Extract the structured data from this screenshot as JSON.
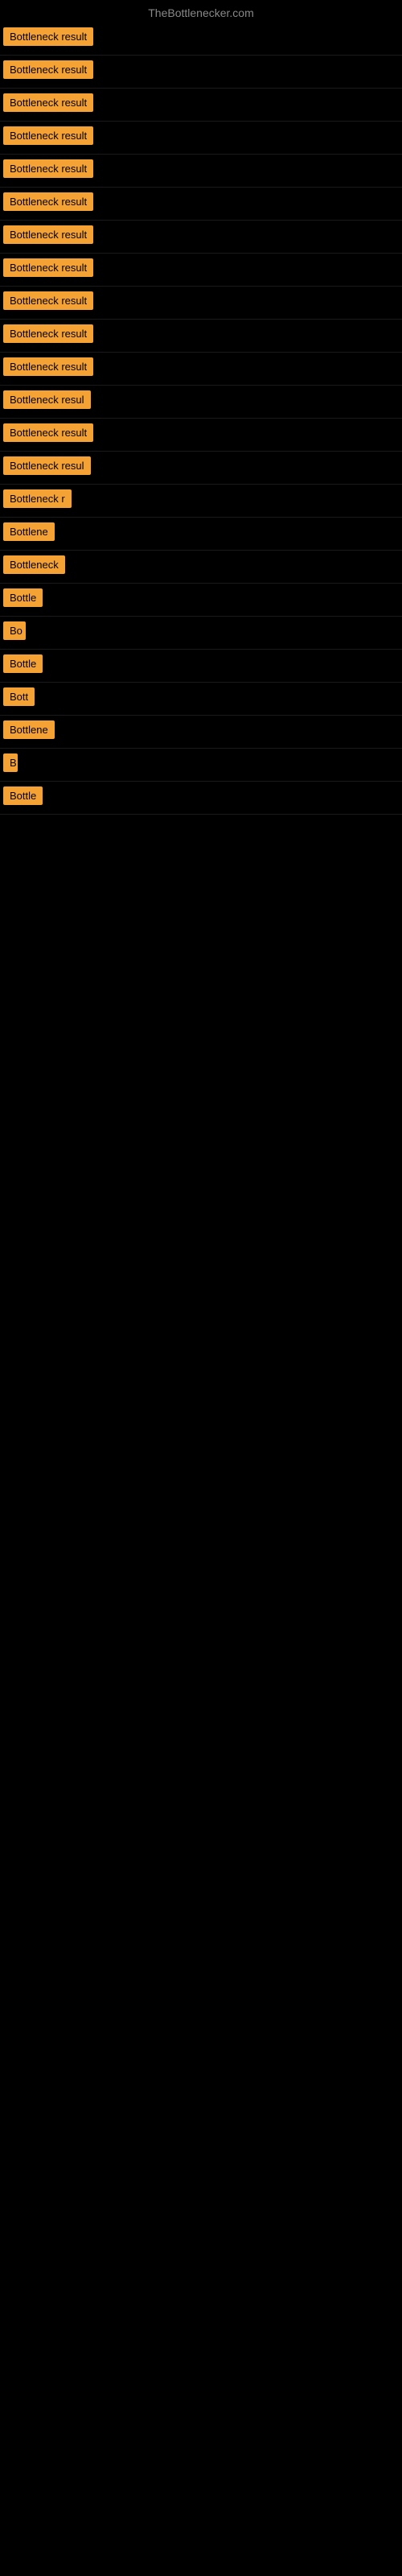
{
  "site": {
    "title": "TheBottlenecker.com"
  },
  "rows": [
    {
      "id": 1,
      "label": "Bottleneck result",
      "width": 160
    },
    {
      "id": 2,
      "label": "Bottleneck result",
      "width": 160
    },
    {
      "id": 3,
      "label": "Bottleneck result",
      "width": 160
    },
    {
      "id": 4,
      "label": "Bottleneck result",
      "width": 160
    },
    {
      "id": 5,
      "label": "Bottleneck result",
      "width": 160
    },
    {
      "id": 6,
      "label": "Bottleneck result",
      "width": 160
    },
    {
      "id": 7,
      "label": "Bottleneck result",
      "width": 160
    },
    {
      "id": 8,
      "label": "Bottleneck result",
      "width": 160
    },
    {
      "id": 9,
      "label": "Bottleneck result",
      "width": 160
    },
    {
      "id": 10,
      "label": "Bottleneck result",
      "width": 160
    },
    {
      "id": 11,
      "label": "Bottleneck result",
      "width": 155
    },
    {
      "id": 12,
      "label": "Bottleneck resul",
      "width": 148
    },
    {
      "id": 13,
      "label": "Bottleneck result",
      "width": 155
    },
    {
      "id": 14,
      "label": "Bottleneck resul",
      "width": 148
    },
    {
      "id": 15,
      "label": "Bottleneck r",
      "width": 100
    },
    {
      "id": 16,
      "label": "Bottlene",
      "width": 78
    },
    {
      "id": 17,
      "label": "Bottleneck",
      "width": 88
    },
    {
      "id": 18,
      "label": "Bottle",
      "width": 60
    },
    {
      "id": 19,
      "label": "Bo",
      "width": 28
    },
    {
      "id": 20,
      "label": "Bottle",
      "width": 60
    },
    {
      "id": 21,
      "label": "Bott",
      "width": 44
    },
    {
      "id": 22,
      "label": "Bottlene",
      "width": 78
    },
    {
      "id": 23,
      "label": "B",
      "width": 18
    },
    {
      "id": 24,
      "label": "Bottle",
      "width": 60
    }
  ]
}
